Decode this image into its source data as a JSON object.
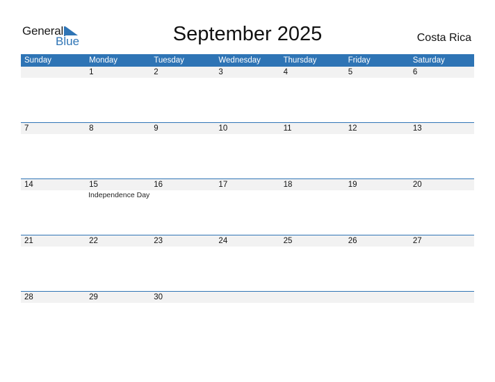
{
  "logo": {
    "general": "General",
    "blue": "Blue"
  },
  "title": "September 2025",
  "country": "Costa Rica",
  "colors": {
    "accent": "#2e74b5",
    "band": "#f2f2f2"
  },
  "weekdays": [
    "Sunday",
    "Monday",
    "Tuesday",
    "Wednesday",
    "Thursday",
    "Friday",
    "Saturday"
  ],
  "weeks": [
    {
      "days": [
        "",
        "1",
        "2",
        "3",
        "4",
        "5",
        "6"
      ],
      "events": [
        "",
        "",
        "",
        "",
        "",
        "",
        ""
      ]
    },
    {
      "days": [
        "7",
        "8",
        "9",
        "10",
        "11",
        "12",
        "13"
      ],
      "events": [
        "",
        "",
        "",
        "",
        "",
        "",
        ""
      ]
    },
    {
      "days": [
        "14",
        "15",
        "16",
        "17",
        "18",
        "19",
        "20"
      ],
      "events": [
        "",
        "Independence Day",
        "",
        "",
        "",
        "",
        ""
      ]
    },
    {
      "days": [
        "21",
        "22",
        "23",
        "24",
        "25",
        "26",
        "27"
      ],
      "events": [
        "",
        "",
        "",
        "",
        "",
        "",
        ""
      ]
    },
    {
      "days": [
        "28",
        "29",
        "30",
        "",
        "",
        "",
        ""
      ],
      "events": [
        "",
        "",
        "",
        "",
        "",
        "",
        ""
      ]
    }
  ]
}
